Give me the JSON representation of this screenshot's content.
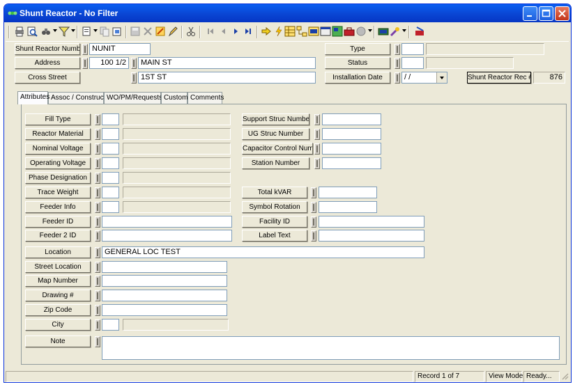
{
  "window": {
    "title": "Shunt Reactor - No Filter"
  },
  "header": {
    "shunt_reactor_number": {
      "label": "Shunt Reactor Number",
      "value": "NUNIT"
    },
    "address": {
      "label": "Address",
      "number": "100 1/2",
      "street": "MAIN ST"
    },
    "cross_street": {
      "label": "Cross Street",
      "value": "1ST ST"
    },
    "type": {
      "label": "Type",
      "code": "",
      "description": ""
    },
    "status": {
      "label": "Status",
      "code": "",
      "description": ""
    },
    "installation_date": {
      "label": "Installation Date",
      "value": " / /"
    },
    "rec_button": {
      "label": "Shunt Reactor Rec #",
      "value": "876"
    }
  },
  "tabs": [
    "Attributes",
    "Assoc / Construct",
    "WO/PM/Requests",
    "Custom",
    "Comments"
  ],
  "left_fields": {
    "fill_type": {
      "label": "Fill Type",
      "code": "",
      "description": ""
    },
    "reactor_material": {
      "label": "Reactor Material",
      "code": "",
      "description": ""
    },
    "nominal_voltage": {
      "label": "Nominal Voltage",
      "code": "",
      "description": ""
    },
    "operating_voltage": {
      "label": "Operating Voltage",
      "code": "",
      "description": ""
    },
    "phase_designation": {
      "label": "Phase Designation",
      "code": "",
      "description": ""
    },
    "trace_weight": {
      "label": "Trace Weight",
      "code": "",
      "description": ""
    },
    "feeder_info": {
      "label": "Feeder Info",
      "code": "",
      "description": ""
    },
    "feeder_id": {
      "label": "Feeder ID",
      "value": ""
    },
    "feeder_2_id": {
      "label": "Feeder 2 ID",
      "value": ""
    },
    "location": {
      "label": "Location",
      "value": "GENERAL LOC TEST"
    },
    "street_location": {
      "label": "Street Location",
      "value": ""
    },
    "map_number": {
      "label": "Map Number",
      "value": ""
    },
    "drawing": {
      "label": "Drawing #",
      "value": ""
    },
    "zip_code": {
      "label": "Zip Code",
      "value": ""
    },
    "city": {
      "label": "City",
      "code": "",
      "description": ""
    },
    "note": {
      "label": "Note",
      "value": ""
    }
  },
  "right_fields": {
    "support_struc_number": {
      "label": "Support Struc Number",
      "value": ""
    },
    "ug_struc_number": {
      "label": "UG Struc Number",
      "value": ""
    },
    "capacitor_control_number": {
      "label": "Capacitor Control Number",
      "value": ""
    },
    "station_number": {
      "label": "Station Number",
      "value": ""
    },
    "total_kvar": {
      "label": "Total kVAR",
      "value": ""
    },
    "symbol_rotation": {
      "label": "Symbol Rotation",
      "value": ""
    },
    "facility_id": {
      "label": "Facility ID",
      "value": ""
    },
    "label_text": {
      "label": "Label Text",
      "value": ""
    }
  },
  "status_bar": {
    "record": "Record 1 of 7",
    "mode": "View Mode",
    "state": "Ready..."
  },
  "colors": {
    "title_bar": "#0a48d6",
    "window_bg": "#ece9d8",
    "field_border": "#7f9db9"
  }
}
